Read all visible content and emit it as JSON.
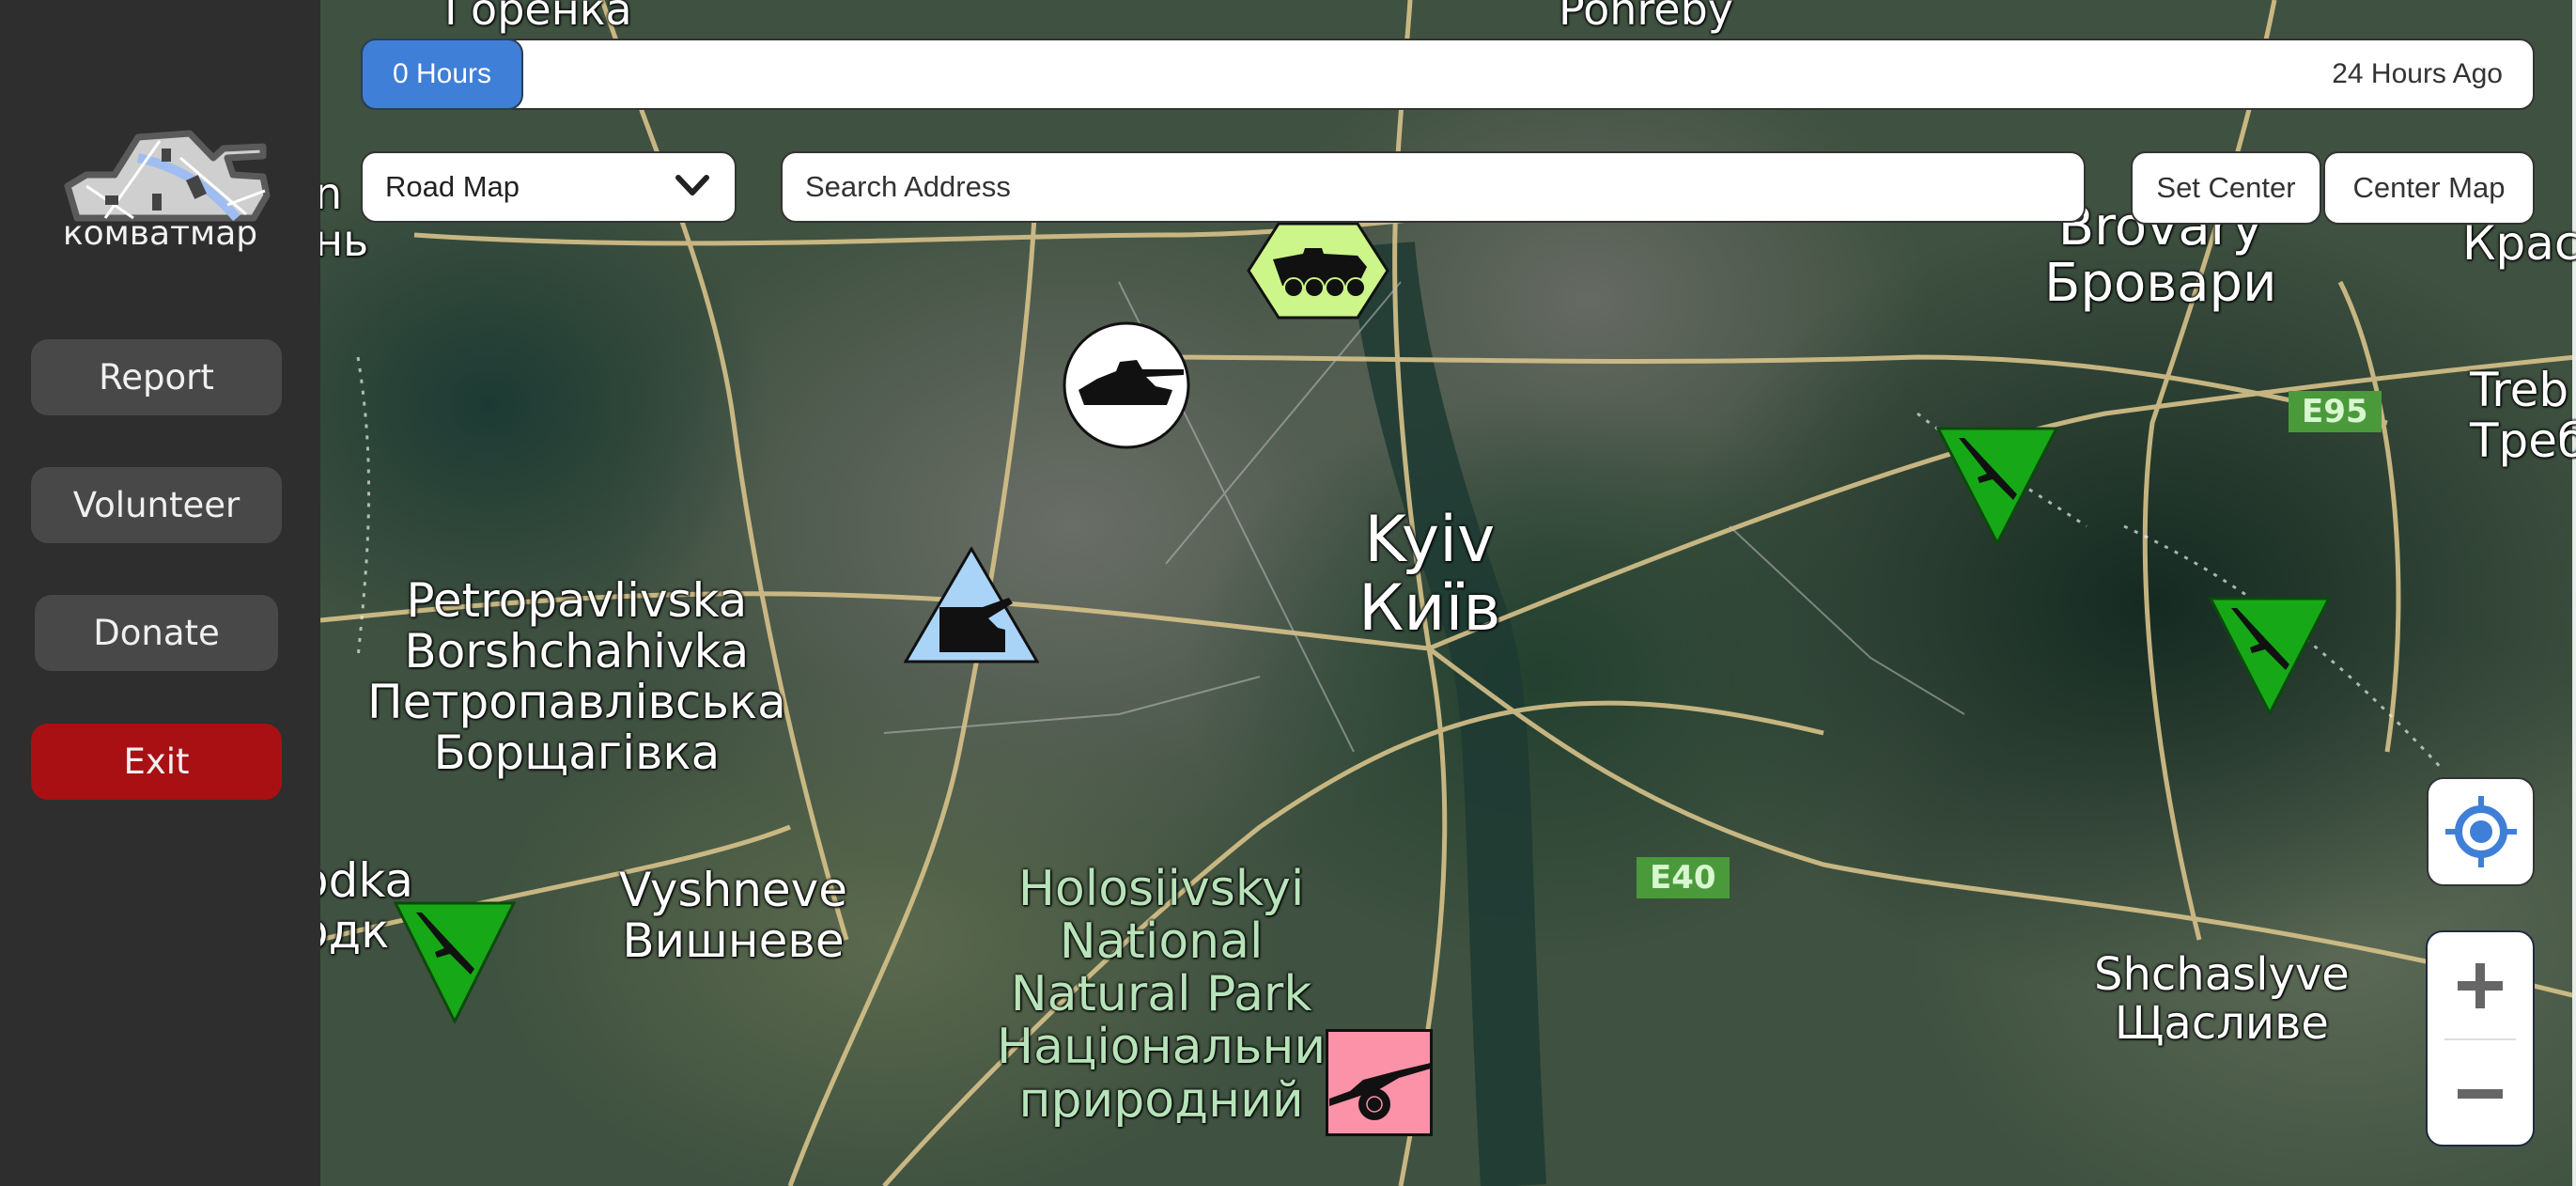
{
  "app": {
    "logo_text": "комватмар",
    "logo_icon": "tank-map-logo-icon"
  },
  "sidebar": {
    "buttons": [
      {
        "id": "report",
        "label": "Report"
      },
      {
        "id": "volunteer",
        "label": "Volunteer"
      },
      {
        "id": "donate",
        "label": "Donate"
      },
      {
        "id": "exit",
        "label": "Exit"
      }
    ]
  },
  "time_slider": {
    "value_label": "0 Hours",
    "end_label": "24 Hours Ago",
    "value_fraction": 0,
    "accent_color": "#3f7fd8"
  },
  "map_controls": {
    "map_type": {
      "selected": "Road Map",
      "icon": "chevron-down-icon"
    },
    "search": {
      "placeholder": "Search Address",
      "value": ""
    },
    "set_center_label": "Set Center",
    "center_map_label": "Center Map",
    "locate_icon": "crosshair-target-icon",
    "zoom_in_icon": "plus-icon",
    "zoom_out_icon": "minus-icon"
  },
  "map_labels": {
    "kyiv": "Kyiv\nКиїв",
    "brovary": "Brovary\nБровари",
    "petropavlivska": "Petropavlivska\nBorshchahivka\nПетропавлівська\nБорщагівка",
    "vyshneve": "Vyshneve\nВишневе",
    "holosiivskyi": "Holosiivskyi\nNational\nNatural Park\nНаціональни\nприродний",
    "shchaslyve": "Shchaslyve\nЩасливе",
    "horenka": "Горенка",
    "rohozhe": "Pohreby",
    "krasylivka": "Крас",
    "trebukhiv": "Treb\nТреб",
    "left_edge_1": "n\nнь",
    "left_edge_2": "odka\nодк",
    "route_e95": "E95",
    "route_e40": "E40"
  },
  "markers": [
    {
      "type": "tank",
      "shape": "circle",
      "color": "#ffffff",
      "icon": "tank-icon"
    },
    {
      "type": "armored-personnel-carrier",
      "shape": "hexagon",
      "color": "#ccf58a",
      "icon": "apc-icon"
    },
    {
      "type": "rocket-launcher",
      "shape": "triangle",
      "color": "#a9d4f7",
      "icon": "rocket-launcher-icon"
    },
    {
      "type": "infantry",
      "shape": "inverted-triangle",
      "color": "#17a817",
      "icon": "rifle-icon"
    },
    {
      "type": "infantry",
      "shape": "inverted-triangle",
      "color": "#17a817",
      "icon": "rifle-icon"
    },
    {
      "type": "infantry",
      "shape": "inverted-triangle",
      "color": "#17a817",
      "icon": "rifle-icon"
    },
    {
      "type": "artillery",
      "shape": "square",
      "color": "#fb92a8",
      "icon": "artillery-icon"
    }
  ]
}
